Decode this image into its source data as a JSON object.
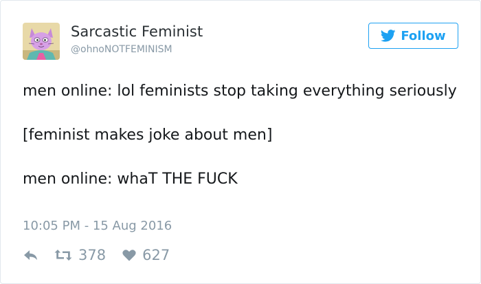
{
  "user": {
    "display_name": "Sarcastic Feminist",
    "handle": "@ohnoNOTFEMINISM",
    "avatar_icon": "cartoon-cat-avatar"
  },
  "follow_button": {
    "label": "Follow",
    "icon": "twitter-bird-icon",
    "color": "#1da1f2"
  },
  "tweet": {
    "lines": [
      "men online: lol feminists stop taking everything seriously",
      "[feminist makes joke about men]",
      "men online: whaT THE FUCK"
    ],
    "timestamp": "10:05 PM - 15 Aug 2016"
  },
  "actions": {
    "reply_icon": "reply-icon",
    "retweet_icon": "retweet-icon",
    "retweet_count": "378",
    "like_icon": "heart-icon",
    "like_count": "627"
  },
  "colors": {
    "text": "#14171a",
    "muted": "#8899a6",
    "border": "#e1e8ed",
    "accent": "#1da1f2"
  }
}
